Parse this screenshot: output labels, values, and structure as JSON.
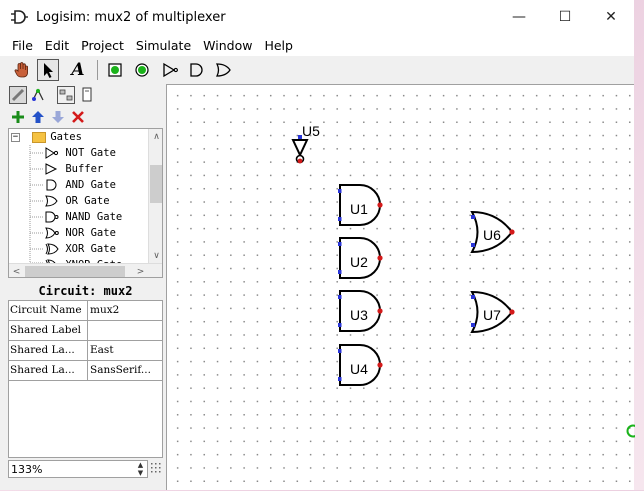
{
  "window": {
    "title": "Logisim: mux2 of multiplexer"
  },
  "window_buttons": {
    "minimize": "—",
    "maximize": "☐",
    "close": "✕"
  },
  "menu": [
    "File",
    "Edit",
    "Project",
    "Simulate",
    "Window",
    "Help"
  ],
  "toolbar": {
    "tools": [
      "poke-tool",
      "select-tool",
      "text-tool",
      "input-pin",
      "output-pin",
      "not-gate",
      "and-gate",
      "or-gate"
    ],
    "text_tool_label": "A"
  },
  "explorer": {
    "folder": "Gates",
    "items": [
      "NOT Gate",
      "Buffer",
      "AND Gate",
      "OR Gate",
      "NAND Gate",
      "NOR Gate",
      "XOR Gate",
      "XNOR Gate"
    ],
    "expand_symbol": "−"
  },
  "attributes": {
    "title": "Circuit: mux2",
    "rows": [
      {
        "key": "Circuit Name",
        "value": "mux2"
      },
      {
        "key": "Shared Label",
        "value": ""
      },
      {
        "key": "Shared La...",
        "value": "East"
      },
      {
        "key": "Shared La...",
        "value": "SansSerif..."
      }
    ]
  },
  "zoom": "133%",
  "circuit": {
    "components": [
      {
        "label": "U5",
        "type": "NOT"
      },
      {
        "label": "U1",
        "type": "AND"
      },
      {
        "label": "U2",
        "type": "AND"
      },
      {
        "label": "U3",
        "type": "AND"
      },
      {
        "label": "U4",
        "type": "AND"
      },
      {
        "label": "U6",
        "type": "OR"
      },
      {
        "label": "U7",
        "type": "OR"
      }
    ]
  },
  "colors": {
    "input_port": "#2a36d8",
    "output_port": "#d41a1a",
    "pin_green": "#1bb31b"
  }
}
